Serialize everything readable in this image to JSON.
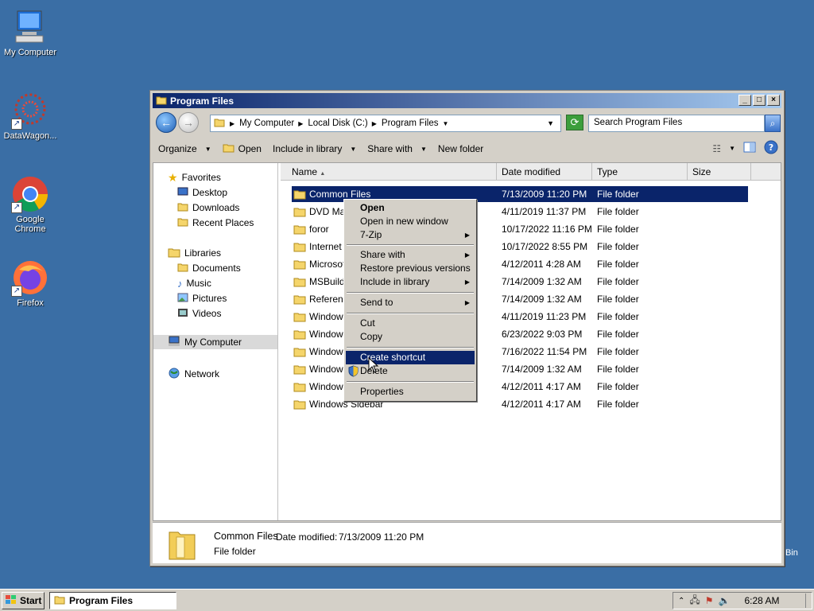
{
  "desktop": {
    "icons": [
      {
        "label": "My Computer"
      },
      {
        "label": "DataWagon..."
      },
      {
        "label": "Google Chrome"
      },
      {
        "label": "Firefox"
      }
    ],
    "recycle_fragment": "Bin"
  },
  "window": {
    "title": "Program Files",
    "controls": {
      "min": "_",
      "max": "□",
      "close": "×"
    }
  },
  "address": {
    "crumbs": [
      "My Computer",
      "Local Disk (C:)",
      "Program Files"
    ],
    "search_placeholder": "Search Program Files"
  },
  "toolbar": {
    "organize": "Organize",
    "open": "Open",
    "include": "Include in library",
    "share": "Share with",
    "newfolder": "New folder"
  },
  "nav": {
    "favorites": "Favorites",
    "desktop": "Desktop",
    "downloads": "Downloads",
    "recent": "Recent Places",
    "libraries": "Libraries",
    "documents": "Documents",
    "music": "Music",
    "pictures": "Pictures",
    "videos": "Videos",
    "computer": "My Computer",
    "network": "Network"
  },
  "columns": {
    "name": "Name",
    "date": "Date modified",
    "type": "Type",
    "size": "Size"
  },
  "rows": [
    {
      "name": "Common Files",
      "date": "7/13/2009 11:20 PM",
      "type": "File folder"
    },
    {
      "name": "DVD Mak",
      "date": "4/11/2019 11:37 PM",
      "type": "File folder"
    },
    {
      "name": "foror",
      "date": "10/17/2022 11:16 PM",
      "type": "File folder"
    },
    {
      "name": "Internet",
      "date": "10/17/2022 8:55 PM",
      "type": "File folder"
    },
    {
      "name": "Microsoft",
      "date": "4/12/2011 4:28 AM",
      "type": "File folder"
    },
    {
      "name": "MSBuild",
      "date": "7/14/2009 1:32 AM",
      "type": "File folder"
    },
    {
      "name": "Referenc",
      "date": "7/14/2009 1:32 AM",
      "type": "File folder"
    },
    {
      "name": "Windows",
      "date": "4/11/2019 11:23 PM",
      "type": "File folder"
    },
    {
      "name": "Windows",
      "date": "6/23/2022 9:03 PM",
      "type": "File folder"
    },
    {
      "name": "Windows",
      "date": "7/16/2022 11:54 PM",
      "type": "File folder"
    },
    {
      "name": "Windows",
      "date": "7/14/2009 1:32 AM",
      "type": "File folder"
    },
    {
      "name": "Windows",
      "date": "4/12/2011 4:17 AM",
      "type": "File folder"
    },
    {
      "name": "Windows Sidebar",
      "date": "4/12/2011 4:17 AM",
      "type": "File folder"
    }
  ],
  "context_menu": {
    "open": "Open",
    "open_new": "Open in new window",
    "zip": "7-Zip",
    "share": "Share with",
    "restore": "Restore previous versions",
    "include": "Include in library",
    "sendto": "Send to",
    "cut": "Cut",
    "copy": "Copy",
    "shortcut": "Create shortcut",
    "delete": "Delete",
    "properties": "Properties"
  },
  "details": {
    "name": "Common Files",
    "date_label": "Date modified:",
    "date": "7/13/2009 11:20 PM",
    "type": "File folder"
  },
  "taskbar": {
    "start": "Start",
    "task": "Program Files",
    "clock": "6:28 AM"
  }
}
